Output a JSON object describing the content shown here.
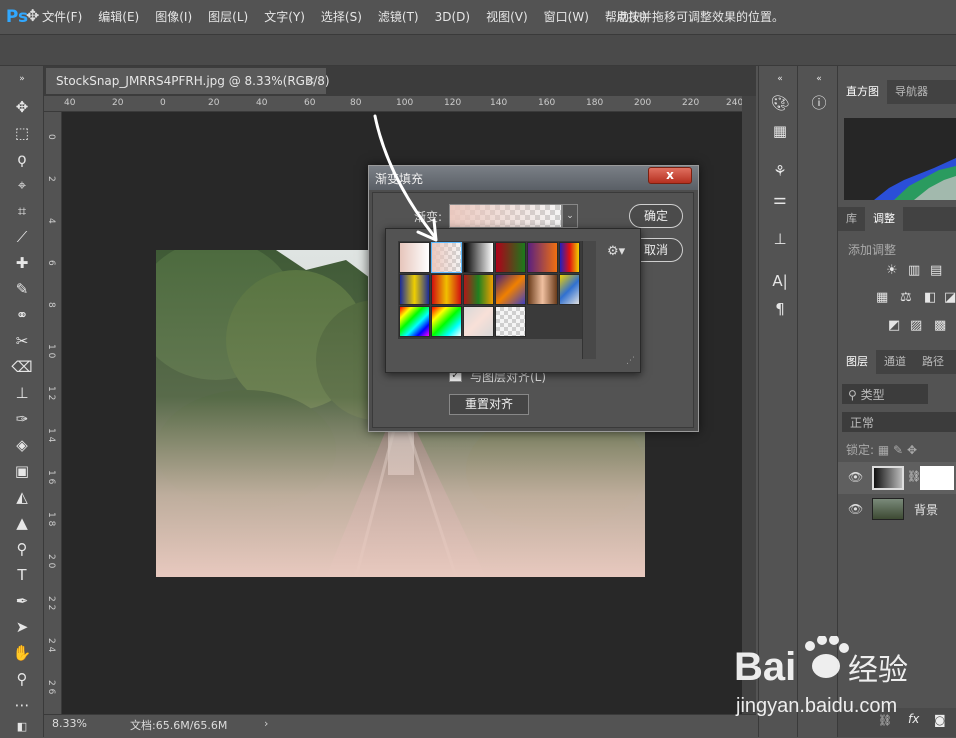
{
  "menubar": {
    "logo": "Ps",
    "items": [
      "文件(F)",
      "编辑(E)",
      "图像(I)",
      "图层(L)",
      "文字(Y)",
      "选择(S)",
      "滤镜(T)",
      "3D(D)",
      "视图(V)",
      "窗口(W)",
      "帮助(H)"
    ]
  },
  "options": {
    "hint": "点按并拖移可调整效果的位置。"
  },
  "document": {
    "tab_title": "StockSnap_JMRRS4PFRH.jpg @ 8.33%(RGB/8)",
    "close": "×",
    "zoom": "8.33%",
    "doc_info": "文档:65.6M/65.6M",
    "ruler_top": [
      "40",
      "20",
      "0",
      "20",
      "40",
      "60",
      "80",
      "100",
      "120",
      "140",
      "160",
      "180",
      "200",
      "220",
      "240"
    ],
    "ruler_left": [
      "0",
      "2",
      "4",
      "6",
      "8",
      "1 0",
      "1 2",
      "1 4",
      "1 6",
      "1 8",
      "2 0",
      "2 2",
      "2 4",
      "2 6"
    ]
  },
  "panels": {
    "histogram_tabs": [
      "直方图",
      "导航器"
    ],
    "adjust_tabs": [
      "库",
      "调整"
    ],
    "adjust_title": "添加调整",
    "layer_tabs": [
      "图层",
      "通道",
      "路径"
    ],
    "layer_search": "类型",
    "blend_mode": "正常",
    "lock_label": "锁定:",
    "layers": [
      {
        "name": ""
      },
      {
        "name": "背景"
      }
    ]
  },
  "dialog": {
    "title": "渐变填充",
    "close": "x",
    "gradient_label": "渐变:",
    "ok": "确定",
    "cancel": "取消",
    "align_label": "与图层对齐(L)",
    "reset": "重置对齐"
  },
  "watermark": {
    "brand": "Bai",
    "brand2": "经验",
    "url": "jingyan.baidu.com"
  }
}
